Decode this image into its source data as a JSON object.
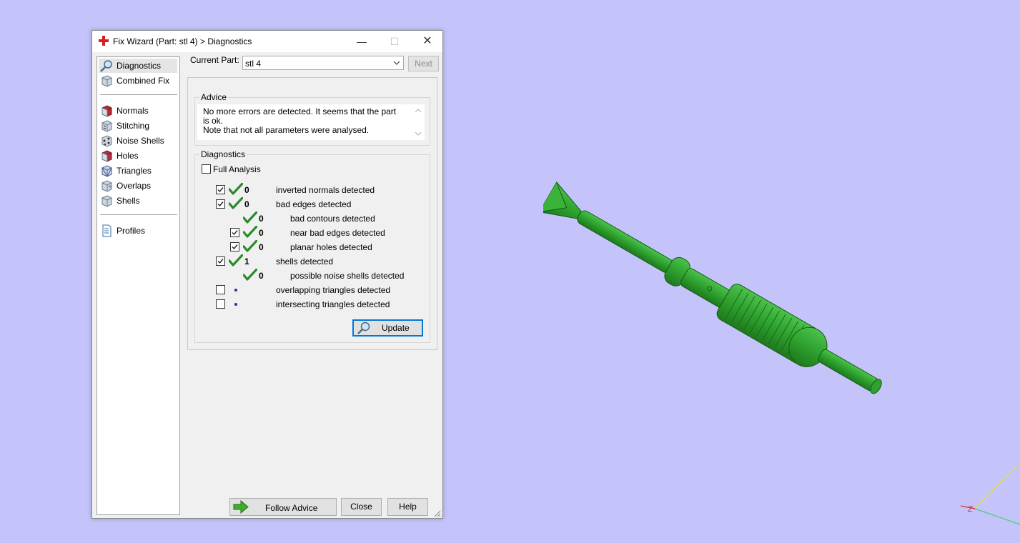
{
  "window": {
    "title": "Fix Wizard (Part: stl 4) > Diagnostics",
    "minimize_glyph": "—",
    "maximize_glyph": "☐",
    "close_glyph": "✕"
  },
  "sidebar": {
    "top_items": [
      {
        "label": "Diagnostics",
        "icon": "magnifier-icon",
        "selected": true
      },
      {
        "label": "Combined Fix",
        "icon": "cube-icon"
      }
    ],
    "tool_items": [
      {
        "label": "Normals",
        "icon": "normals-cube-icon"
      },
      {
        "label": "Stitching",
        "icon": "stitching-cube-icon"
      },
      {
        "label": "Noise Shells",
        "icon": "noise-shells-icon"
      },
      {
        "label": "Holes",
        "icon": "holes-cube-icon"
      },
      {
        "label": "Triangles",
        "icon": "triangles-cube-icon"
      },
      {
        "label": "Overlaps",
        "icon": "overlaps-cube-icon"
      },
      {
        "label": "Shells",
        "icon": "shells-cube-icon"
      }
    ],
    "profiles": {
      "label": "Profiles",
      "icon": "document-icon"
    }
  },
  "header": {
    "current_part_label": "Current Part:",
    "current_part_value": "stl 4",
    "next_label": "Next"
  },
  "advice": {
    "title": "Advice",
    "text": "No more errors are detected. It seems that the part is ok.\nNote that not all parameters were analysed."
  },
  "diagnostics": {
    "title": "Diagnostics",
    "full_analysis_label": "Full Analysis",
    "full_analysis_checked": false,
    "rows": [
      {
        "label": "inverted normals detected",
        "count": "0",
        "checked": true,
        "status": "ok",
        "indent": 0,
        "has_checkbox": true
      },
      {
        "label": "bad edges detected",
        "count": "0",
        "checked": true,
        "status": "ok",
        "indent": 0,
        "has_checkbox": true
      },
      {
        "label": "bad contours detected",
        "count": "0",
        "checked": false,
        "status": "ok",
        "indent": 1,
        "has_checkbox": false
      },
      {
        "label": "near bad edges detected",
        "count": "0",
        "checked": true,
        "status": "ok",
        "indent": 1,
        "has_checkbox": true
      },
      {
        "label": "planar holes detected",
        "count": "0",
        "checked": true,
        "status": "ok",
        "indent": 1,
        "has_checkbox": true
      },
      {
        "label": "shells detected",
        "count": "1",
        "checked": true,
        "status": "ok",
        "indent": 0,
        "has_checkbox": true
      },
      {
        "label": "possible noise shells detected",
        "count": "0",
        "checked": false,
        "status": "ok",
        "indent": 1,
        "has_checkbox": false
      },
      {
        "label": "overlapping triangles detected",
        "count": "",
        "checked": false,
        "status": "pending",
        "indent": 0,
        "has_checkbox": true
      },
      {
        "label": "intersecting triangles detected",
        "count": "",
        "checked": false,
        "status": "pending",
        "indent": 0,
        "has_checkbox": true
      }
    ],
    "update_label": "Update"
  },
  "footer": {
    "follow_advice_label": "Follow Advice",
    "close_label": "Close",
    "help_label": "Help"
  },
  "viewport": {
    "axis_label": "Z",
    "model_color": "#2ea12e",
    "background_color": "#c4c4fb"
  }
}
